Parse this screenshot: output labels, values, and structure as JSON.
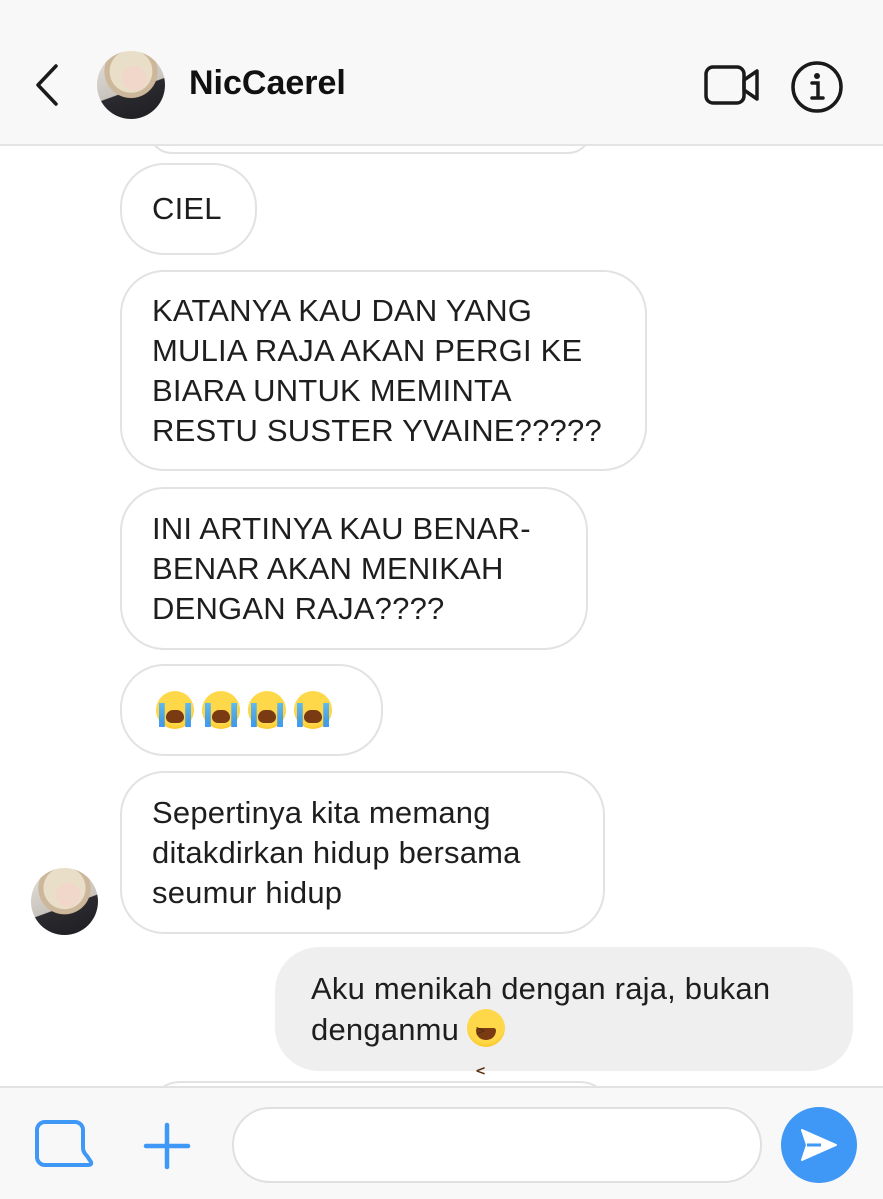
{
  "header": {
    "contact_name": "NicCaerel",
    "back_icon": "chevron-left-icon",
    "video_icon": "video-camera-icon",
    "info_icon": "info-icon"
  },
  "messages": [
    {
      "direction": "incoming",
      "text": "CIEL"
    },
    {
      "direction": "incoming",
      "text": "KATANYA KAU DAN YANG\nMULIA RAJA AKAN PERGI KE\nBIARA UNTUK MEMINTA\nRESTU SUSTER YVAINE?????"
    },
    {
      "direction": "incoming",
      "text": "INI ARTINYA KAU BENAR-\nBENAR AKAN MENIKAH\nDENGAN RAJA????"
    },
    {
      "direction": "incoming",
      "emoji": [
        "loudly-crying-face",
        "loudly-crying-face",
        "loudly-crying-face",
        "loudly-crying-face"
      ]
    },
    {
      "direction": "incoming",
      "text": "Sepertinya kita memang\nditakdirkan hidup bersama\nseumur hidup"
    },
    {
      "direction": "outgoing",
      "text": "Aku menikah dengan raja, bukan\ndenganmu",
      "trailing_emoji": "grinning-squinting-face"
    }
  ],
  "composer": {
    "placeholder": "",
    "gallery_icon": "gallery-icon",
    "plus_icon": "plus-icon",
    "send_icon": "send-icon"
  },
  "colors": {
    "accent": "#3f97f6",
    "header_bg": "#f8f8f8",
    "outgoing_bubble": "#efefef",
    "incoming_border": "#e2e2e2"
  }
}
